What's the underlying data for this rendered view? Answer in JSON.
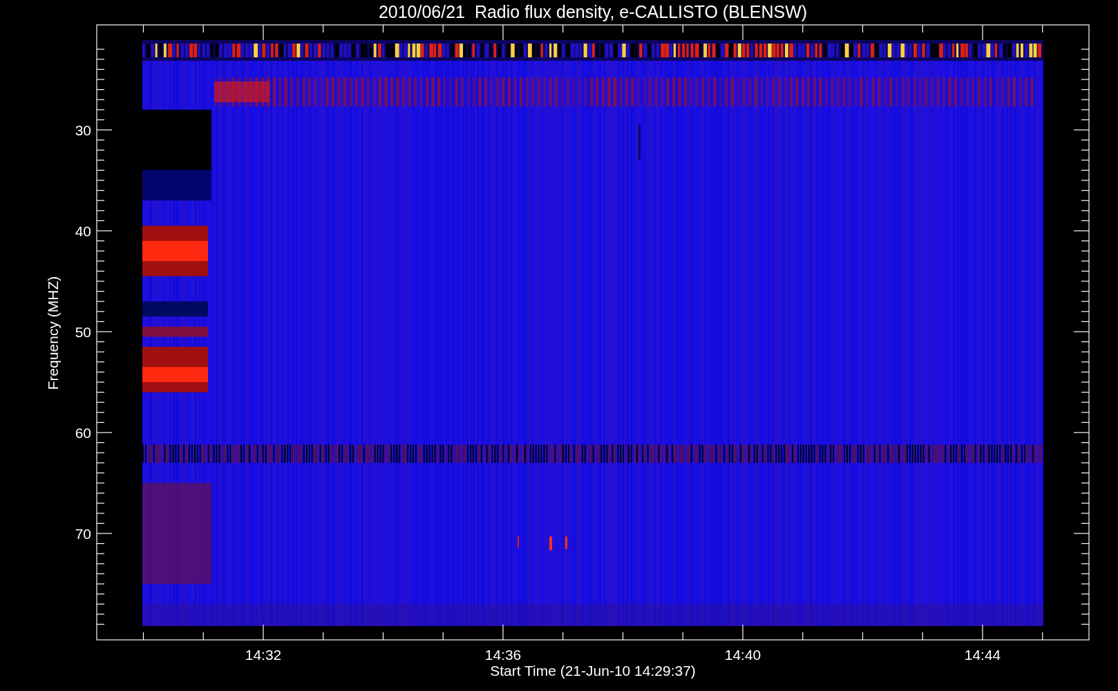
{
  "title": "2010/06/21  Radio flux density, e-CALLISTO (BLENSW)",
  "y_axis": {
    "label": "Frequency (MHZ)",
    "ticks": [
      "30",
      "40",
      "50",
      "60",
      "70"
    ]
  },
  "x_axis": {
    "label": "Start Time (21-Jun-10 14:29:37)",
    "ticks": [
      "14:32",
      "14:36",
      "14:40",
      "14:44"
    ]
  }
}
